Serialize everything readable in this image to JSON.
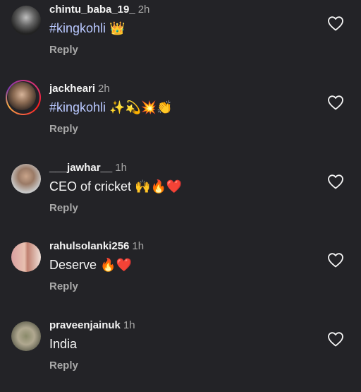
{
  "comments": [
    {
      "username": "chintu_baba_19_",
      "time": "2h",
      "hashtag": "#kingkohli",
      "text": "",
      "emojis": "👑",
      "reply_label": "Reply",
      "avatar": "dark-photo",
      "liked": false
    },
    {
      "username": "jackheari",
      "time": "2h",
      "hashtag": "#kingkohli",
      "text": "",
      "emojis": "✨💫💥👏",
      "reply_label": "Reply",
      "avatar": "story-ring-photo",
      "liked": false
    },
    {
      "username": "___jawhar__",
      "time": "1h",
      "hashtag": "",
      "text": "CEO of cricket",
      "emojis": "🙌🔥❤️",
      "reply_label": "Reply",
      "avatar": "portrait-photo",
      "liked": false
    },
    {
      "username": "rahulsolanki256",
      "time": "1h",
      "hashtag": "",
      "text": "Deserve",
      "emojis": "🔥❤️",
      "reply_label": "Reply",
      "avatar": "couple-photo",
      "liked": false
    },
    {
      "username": "praveenjainuk",
      "time": "1h",
      "hashtag": "",
      "text": "India",
      "emojis": "",
      "reply_label": "Reply",
      "avatar": "outdoor-photo",
      "liked": false
    }
  ],
  "colors": {
    "background": "#232327",
    "hashtag": "#b9c8ff",
    "secondary_text": "#a8a8a8"
  }
}
